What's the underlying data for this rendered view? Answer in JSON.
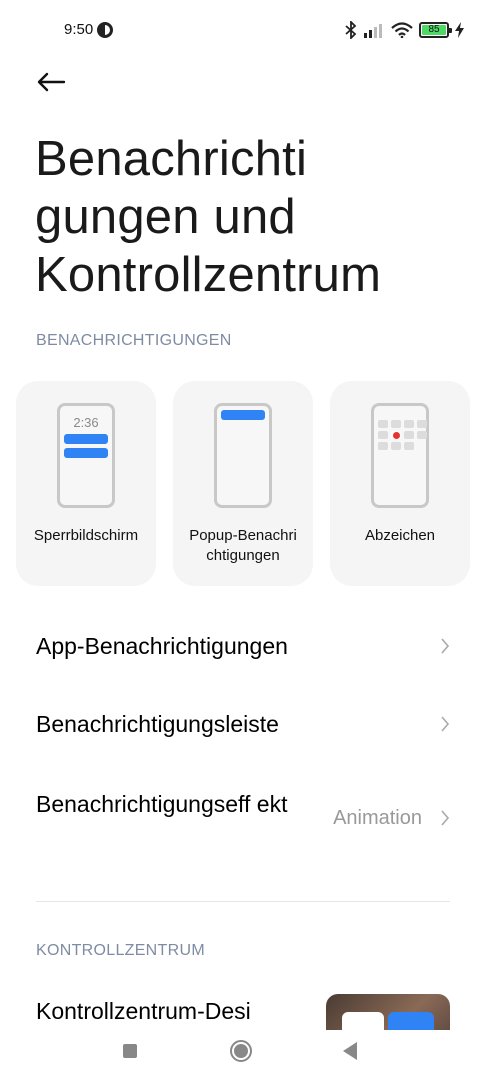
{
  "status_bar": {
    "time": "9:50",
    "battery_level": "85",
    "icons": [
      "bluetooth-icon",
      "signal-icon",
      "wifi-icon",
      "battery-icon",
      "charging-icon"
    ]
  },
  "header": {
    "back_icon": "arrow-left-icon",
    "title": "Benachrichti gungen und Kontrollzentrum"
  },
  "notifications_section": {
    "header": "BENACHRICHTIGUNGEN",
    "cards": [
      {
        "label": "Sperrbildschirm",
        "preview_time": "2:36",
        "icon": "lockscreen-preview"
      },
      {
        "label": "Popup-Benachri chtigungen",
        "icon": "popup-preview"
      },
      {
        "label": "Abzeichen",
        "icon": "badge-preview"
      }
    ],
    "items": [
      {
        "label": "App-Benachrichtigungen",
        "value": ""
      },
      {
        "label": "Benachrichtigungsleiste",
        "value": ""
      },
      {
        "label": "Benachrichtigungseff ekt",
        "value": "Animation"
      }
    ]
  },
  "control_center_section": {
    "header": "KONTROLLZENTRUM",
    "items": [
      {
        "label": "Kontrollzentrum-Desi"
      }
    ]
  },
  "colors": {
    "accent": "#2f83f5",
    "section_header": "#7f8ba3",
    "card_bg": "#f5f5f5",
    "badge_dot": "#e8322d"
  },
  "nav_bar": {
    "icons": [
      "recents-square-icon",
      "home-circle-icon",
      "back-triangle-icon"
    ]
  }
}
